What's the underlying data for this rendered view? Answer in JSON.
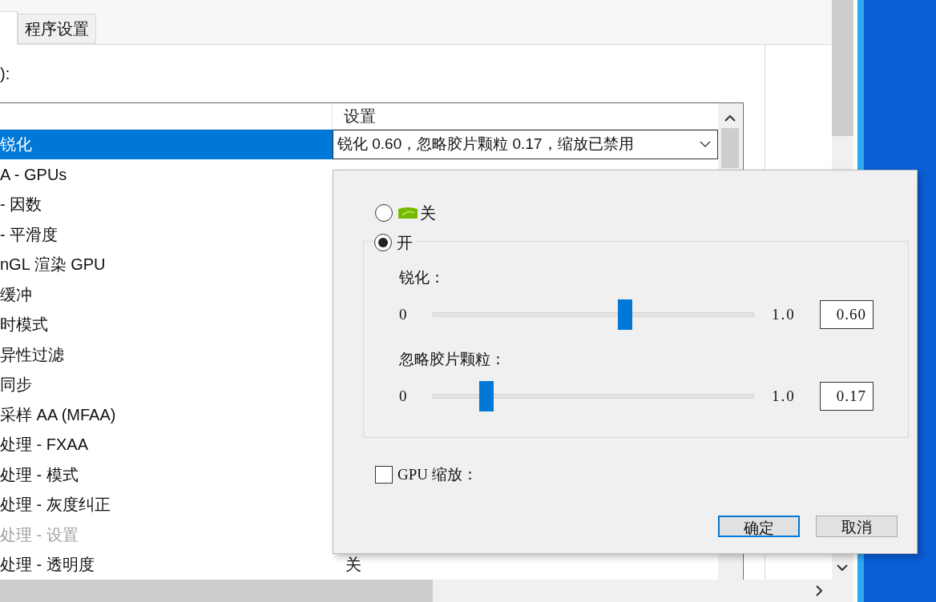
{
  "tabs": [
    {
      "selected": true
    },
    {
      "label": "程序设置",
      "selected": false
    }
  ],
  "list_label": "):",
  "table": {
    "setting_column": "设置",
    "rows": [
      {
        "feature": "锐化",
        "selected": true,
        "disabled": false,
        "setting": "锐化 0.60，忽略胶片颗粒 0.17，缩放已禁用"
      },
      {
        "feature": "A - GPUs",
        "selected": false,
        "disabled": false
      },
      {
        "feature": "- 因数",
        "selected": false,
        "disabled": false
      },
      {
        "feature": "- 平滑度",
        "selected": false,
        "disabled": false
      },
      {
        "feature": "nGL 渲染 GPU",
        "selected": false,
        "disabled": false
      },
      {
        "feature": "缓冲",
        "selected": false,
        "disabled": false
      },
      {
        "feature": "时模式",
        "selected": false,
        "disabled": false
      },
      {
        "feature": "异性过滤",
        "selected": false,
        "disabled": false
      },
      {
        "feature": "同步",
        "selected": false,
        "disabled": false
      },
      {
        "feature": "采样 AA (MFAA)",
        "selected": false,
        "disabled": false
      },
      {
        "feature": "处理 - FXAA",
        "selected": false,
        "disabled": false
      },
      {
        "feature": "处理 - 模式",
        "selected": false,
        "disabled": false
      },
      {
        "feature": "处理 - 灰度纠正",
        "selected": false,
        "disabled": false
      },
      {
        "feature": "处理 - 设置",
        "selected": false,
        "disabled": true
      },
      {
        "feature": "处理 - 透明度",
        "selected": false,
        "disabled": false,
        "setting": "关"
      }
    ]
  },
  "dialog": {
    "options": [
      {
        "label": "关",
        "selected": false,
        "kind": "logo"
      },
      {
        "label": "开",
        "selected": true,
        "kind": "group"
      }
    ],
    "sliders": [
      {
        "label": "锐化：",
        "min": "0",
        "max": "1.0",
        "level": 0.6,
        "value": "0.60"
      },
      {
        "label": "忽略胶片颗粒：",
        "min": "0",
        "max": "1.0",
        "level": 0.17,
        "value": "0.17"
      }
    ],
    "gpu_scaling": {
      "label": "GPU 缩放：",
      "checked": false
    },
    "buttons": [
      {
        "label": "确定",
        "default": true
      },
      {
        "label": "取消",
        "default": false
      }
    ]
  }
}
